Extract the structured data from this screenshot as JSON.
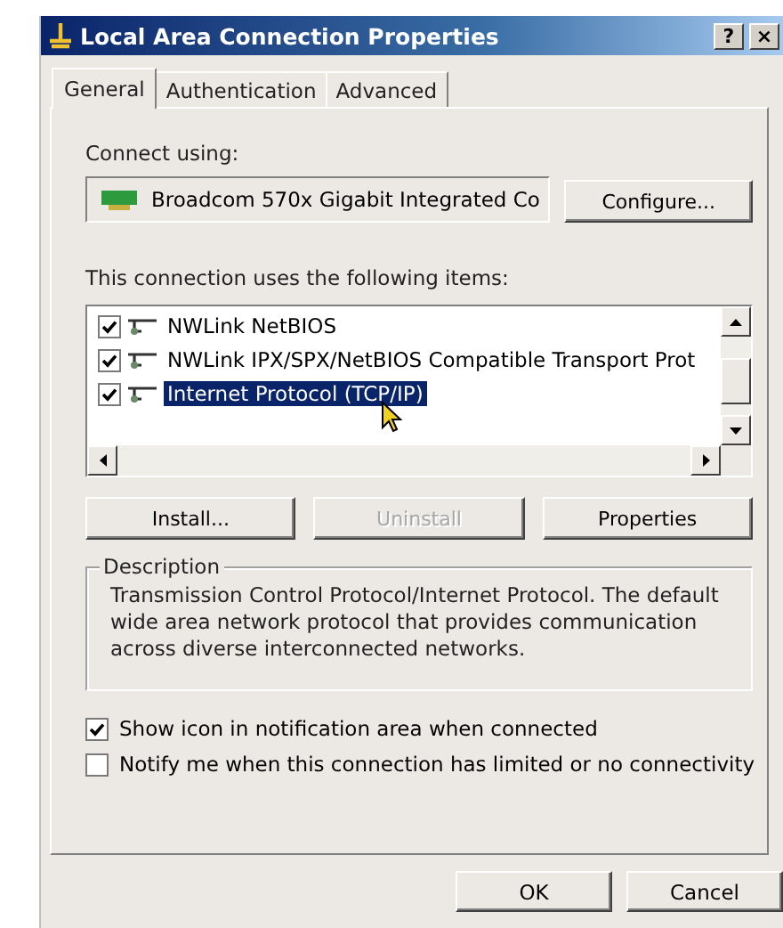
{
  "window": {
    "title": "Local Area Connection Properties",
    "title_buttons": [
      "?",
      "×"
    ]
  },
  "tabs": [
    {
      "label": "General",
      "selected": true
    },
    {
      "label": "Authentication",
      "selected": false
    },
    {
      "label": "Advanced",
      "selected": false
    }
  ],
  "connect_using": {
    "label": "Connect using:",
    "adapter": "Broadcom 570x Gigabit Integrated Co",
    "button": "Configure..."
  },
  "items": {
    "label": "This connection uses the following items:",
    "rows": [
      {
        "name": "NWLink NetBIOS",
        "checked": true,
        "selected": false
      },
      {
        "name": "NWLink IPX/SPX/NetBIOS Compatible Transport Prot",
        "checked": true,
        "selected": false
      },
      {
        "name": "Internet Protocol (TCP/IP)",
        "checked": true,
        "selected": true
      }
    ]
  },
  "item_buttons": [
    {
      "label": "Install...",
      "disabled": false
    },
    {
      "label": "Uninstall",
      "disabled": true
    },
    {
      "label": "Properties",
      "disabled": false
    }
  ],
  "description": {
    "title": "Description",
    "text": "Transmission Control Protocol/Internet Protocol. The default wide area network protocol that provides communication across diverse interconnected networks."
  },
  "options": [
    {
      "label": "Show icon in notification area when connected",
      "checked": true
    },
    {
      "label": "Notify me when this connection has limited or no connectivity",
      "checked": false
    }
  ],
  "buttons": [
    "OK",
    "Cancel"
  ]
}
